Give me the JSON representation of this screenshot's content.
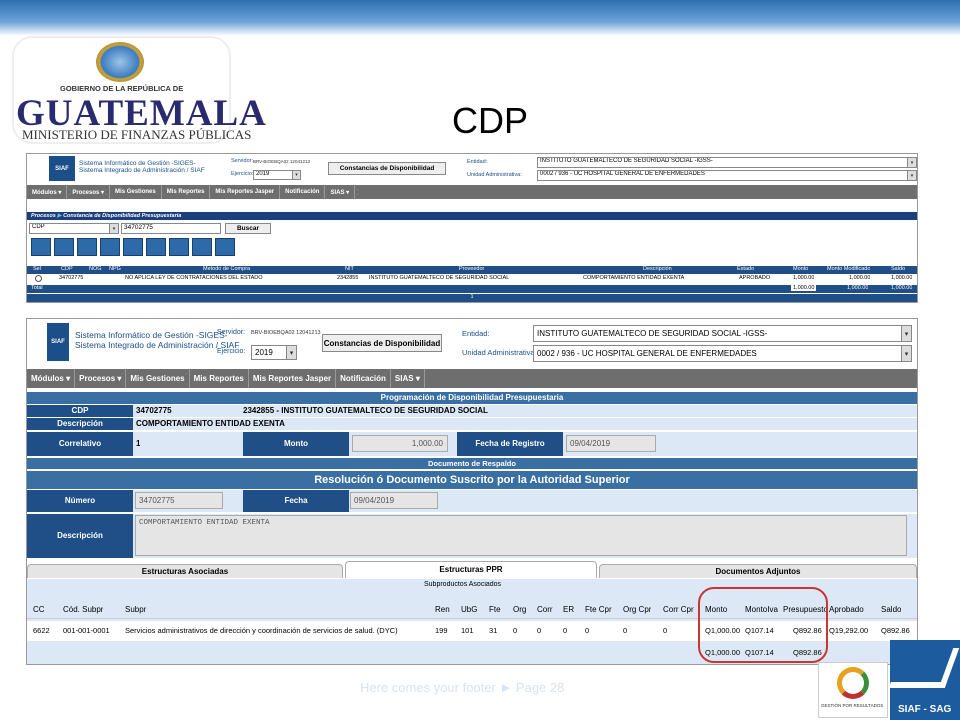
{
  "slide": {
    "title": "CDP",
    "footer": "Here comes your footer  ►  Page 28"
  },
  "logo": {
    "gov_text": "GOBIERNO DE LA REPÚBLICA DE",
    "country": "GUATEMALA",
    "ministry": "MINISTERIO DE FINANZAS PÚBLICAS"
  },
  "header": {
    "system_line1": "Sistema Informático de Gestión -SIGES-",
    "system_line2": "Sistema Integrado de Administración / SIAF",
    "siaf_label": "SIAF",
    "servidor_label": "Servidor:",
    "servidor_value": "BRV-BIOEBQA02 12041213",
    "ejercicio_label": "Ejercicio:",
    "ejercicio_value": "2019",
    "constancias_button": "Constancias de Disponibilidad",
    "entidad_label": "Entidad:",
    "entidad_value": "INSTITUTO GUATEMALTECO DE SEGURIDAD SOCIAL -IGSS-",
    "unidad_label": "Unidad Administrativa:",
    "unidad_value": "0002 / 936 - UC HOSPITAL GENERAL DE ENFERMEDADES"
  },
  "menu": [
    "Módulos ▾",
    "Procesos ▾",
    "Mis Gestiones",
    "Mis Reportes",
    "Mis Reportes Jasper",
    "Notificación",
    "SIAS ▾"
  ],
  "screen1": {
    "breadcrumb_root": "Procesos",
    "breadcrumb_page": "Constancia de Disponibilidad Presupuestaria",
    "filter_select": "CDP",
    "filter_value": "34702775",
    "search_button": "Buscar",
    "columns": [
      "Sel",
      "CDP",
      "NOG",
      "NPG",
      "Metodo de Compra",
      "NIT",
      "Proveedor",
      "Descripción",
      "Estado",
      "Monto",
      "Monto Modificado",
      "Saldo"
    ],
    "row": {
      "cdp": "34702775",
      "nog": "",
      "npg": "",
      "metodo": "NO APLICA LEY DE CONTRATACIONES DEL ESTADO",
      "nit": "2342855",
      "proveedor": "INSTITUTO GUATEMALTECO DE SEGURIDAD SOCIAL",
      "descripcion": "COMPORTAMIENTO ENTIDAD EXENTA",
      "estado": "APROBADO",
      "monto": "1,000.00",
      "monto_mod": "1,000.00",
      "saldo": "1,000.00"
    },
    "total_label": "Total",
    "total": {
      "monto": "1,000.00",
      "monto_mod": "1,000.00",
      "saldo": "1,000.00"
    },
    "page": "1"
  },
  "screen2": {
    "band1": "Programación de Disponibilidad Presupuestaria",
    "cdp_label": "CDP",
    "cdp_value": "34702775",
    "cdp_entity": "2342855 - INSTITUTO GUATEMALTECO DE SEGURIDAD SOCIAL",
    "descripcion_label": "Descripción",
    "descripcion_value": "COMPORTAMIENTO ENTIDAD EXENTA",
    "correlativo_label": "Correlativo",
    "correlativo_value": "1",
    "monto_label": "Monto",
    "monto_value": "1,000.00",
    "fecha_registro_label": "Fecha de Registro",
    "fecha_registro_value": "09/04/2019",
    "band2": "Documento de Respaldo",
    "band3": "Resolución ó Documento Suscrito por la Autoridad Superior",
    "numero_label": "Número",
    "numero_value": "34702775",
    "fecha_label": "Fecha",
    "fecha_value": "09/04/2019",
    "desc2_label": "Descripción",
    "desc2_value": "COMPORTAMIENTO ENTIDAD EXENTA",
    "tabs": [
      "Estructuras Asociadas",
      "Estructuras PPR",
      "Documentos Adjuntos"
    ],
    "group_header": "Subproductos Asociados",
    "columns": [
      "CC",
      "Cód. Subpr",
      "Subpr",
      "Ren",
      "UbG",
      "Fte",
      "Org",
      "Corr",
      "ER",
      "Fte Cpr",
      "Org Cpr",
      "Corr Cpr",
      "Monto",
      "MontoIva",
      "Presupuesto",
      "Aprobado",
      "Saldo"
    ],
    "row": [
      "6622",
      "001-001-0001",
      "Servicios administrativos de dirección y coordinación de servicios de salud. (DYC)",
      "199",
      "101",
      "31",
      "0",
      "0",
      "0",
      "0",
      "0",
      "0",
      "Q1,000.00",
      "Q107.14",
      "Q892.86",
      "Q19,292.00",
      "Q892.86"
    ],
    "totals": {
      "monto": "Q1,000.00",
      "montoiva": "Q107.14",
      "presupuesto": "Q892.86"
    }
  },
  "brand": {
    "gpr_text": "GESTIÓN POR RESULTADOS",
    "siaf_sag": "SIAF - SAG"
  }
}
